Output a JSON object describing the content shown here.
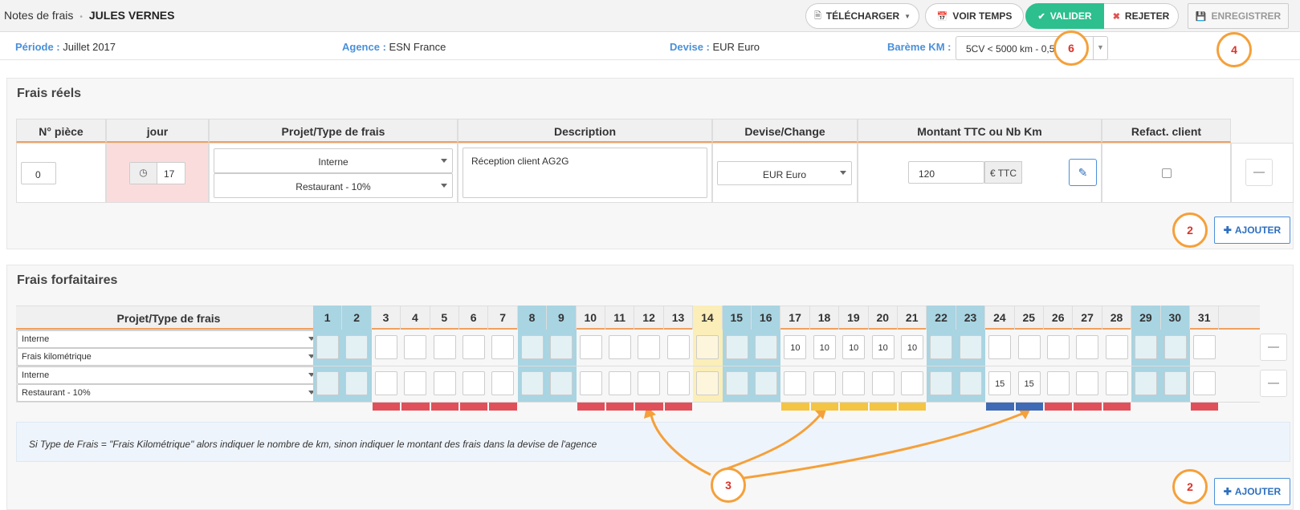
{
  "header": {
    "breadcrumb_root": "Notes de frais",
    "breadcrumb_separator": "•",
    "user_name": "JULES VERNES",
    "buttons": {
      "telecharger": "TÉLÉCHARGER",
      "voir_temps": "VOIR TEMPS",
      "valider": "VALIDER",
      "rejeter": "REJETER",
      "enregistrer": "ENREGISTRER"
    }
  },
  "info": {
    "periode_label": "Période :",
    "periode_value": "Juillet 2017",
    "agence_label": "Agence :",
    "agence_value": "ESN France",
    "devise_label": "Devise :",
    "devise_value": "EUR Euro",
    "bareme_label": "Barème KM :",
    "bareme_value": "5CV < 5000 km - 0,5"
  },
  "frais_reels": {
    "title": "Frais réels",
    "columns": [
      "N° pièce",
      "jour",
      "Projet/Type de frais",
      "Description",
      "Devise/Change",
      "Montant TTC ou Nb Km",
      "Refact. client"
    ],
    "row": {
      "piece": "0",
      "jour": "17",
      "projet": "Interne",
      "type": "Restaurant - 10%",
      "description": "Réception client AG2G",
      "devise": "EUR Euro",
      "montant": "120",
      "unit": "€ TTC"
    },
    "add_label": "AJOUTER"
  },
  "frais_forfaitaires": {
    "title": "Frais forfaitaires",
    "column_label": "Projet/Type de frais",
    "days": [
      "1",
      "2",
      "3",
      "4",
      "5",
      "6",
      "7",
      "8",
      "9",
      "10",
      "11",
      "12",
      "13",
      "14",
      "15",
      "16",
      "17",
      "18",
      "19",
      "20",
      "21",
      "22",
      "23",
      "24",
      "25",
      "26",
      "27",
      "28",
      "29",
      "30",
      "31"
    ],
    "rows": [
      {
        "projet": "Interne",
        "type": "Frais kilométrique",
        "values": {
          "17": "10",
          "18": "10",
          "19": "10",
          "20": "10",
          "21": "10"
        }
      },
      {
        "projet": "Interne",
        "type": "Restaurant - 10%",
        "values": {
          "24": "15",
          "25": "15"
        }
      }
    ],
    "note": "Si Type de Frais = \"Frais Kilométrique\" alors indiquer le nombre de km, sinon indiquer le montant des frais dans la devise de l'agence",
    "add_label": "AJOUTER"
  },
  "annotations": [
    "6",
    "4",
    "2",
    "3",
    "2"
  ],
  "colors": {
    "weekend": "#a9d4e2",
    "holiday": "#fbeeb8",
    "red_strip": "#e0505a",
    "yellow_strip": "#f4c542",
    "blue_strip": "#3f6ab5",
    "annotation_ring": "#f5a03a",
    "valider": "#2dbf8e"
  }
}
